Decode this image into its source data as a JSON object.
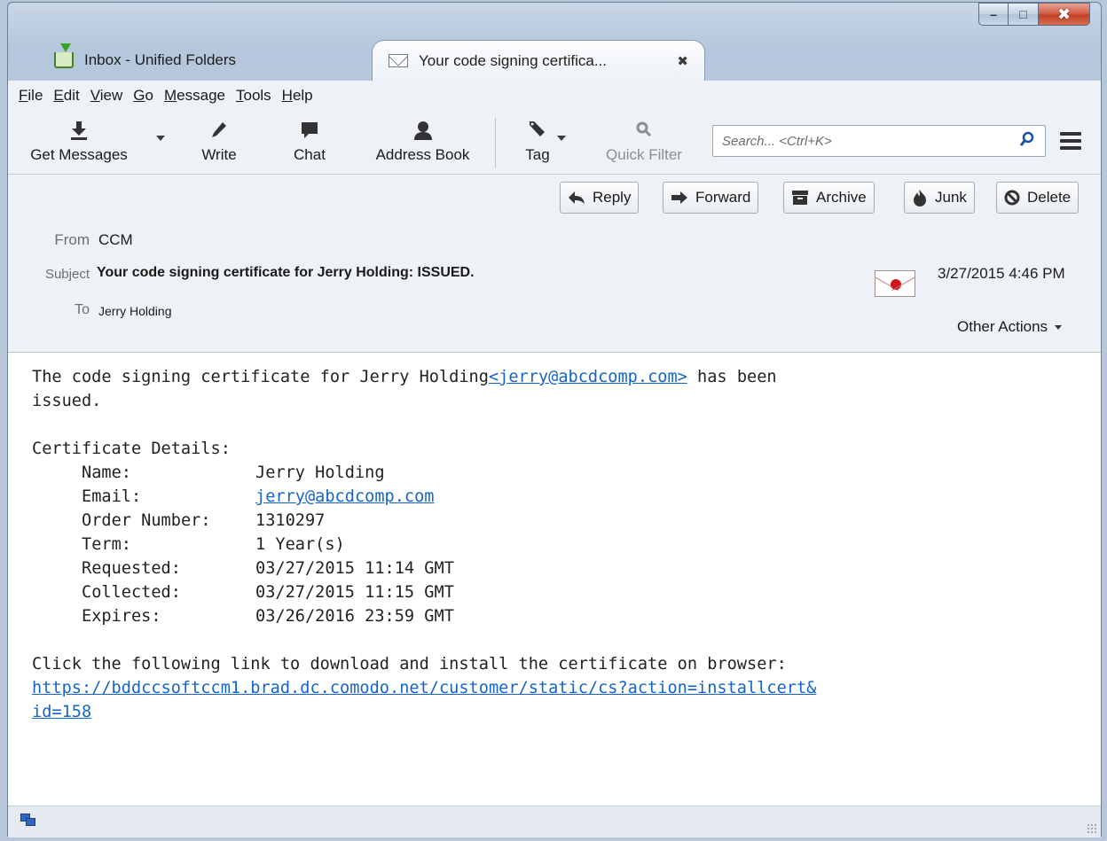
{
  "window": {
    "controls": {
      "minimize": "–",
      "maximize": "□",
      "close": "✖"
    }
  },
  "tabs": [
    {
      "title": "Inbox - Unified Folders",
      "icon": "inbox-download-icon",
      "active": false
    },
    {
      "title": "Your code signing certifica...",
      "icon": "envelope-icon",
      "active": true,
      "close": "✖"
    }
  ],
  "menubar": {
    "items": [
      {
        "key": "F",
        "rest": "ile"
      },
      {
        "key": "E",
        "rest": "dit"
      },
      {
        "key": "V",
        "rest": "iew"
      },
      {
        "key": "G",
        "rest": "o"
      },
      {
        "key": "M",
        "rest": "essage"
      },
      {
        "key": "T",
        "rest": "ools"
      },
      {
        "key": "H",
        "rest": "elp"
      }
    ]
  },
  "toolbar": {
    "get_messages": "Get Messages",
    "write": "Write",
    "chat": "Chat",
    "address_book": "Address Book",
    "tag": "Tag",
    "quick_filter": "Quick Filter",
    "search_placeholder": "Search... <Ctrl+K>"
  },
  "header_actions": {
    "reply": "Reply",
    "forward": "Forward",
    "archive": "Archive",
    "junk": "Junk",
    "delete": "Delete"
  },
  "message": {
    "from_label": "From",
    "from": "CCM",
    "subject_label": "Subject",
    "subject": "Your code signing certificate for Jerry Holding: ISSUED.",
    "to_label": "To",
    "to": "Jerry Holding",
    "date": "3/27/2015 4:46 PM",
    "other_actions": "Other Actions"
  },
  "body": {
    "intro_a": "The code signing certificate for Jerry Holding",
    "intro_link": "<jerry@abcdcomp.com>",
    "intro_b": " has been",
    "intro_c": "issued.",
    "details_heading": "Certificate Details:",
    "details": [
      {
        "key": "Name:",
        "value": "Jerry Holding",
        "link": false
      },
      {
        "key": "Email:",
        "value": "jerry@abcdcomp.com",
        "link": true
      },
      {
        "key": "Order Number:",
        "value": "1310297",
        "link": false
      },
      {
        "key": "Term:",
        "value": "1 Year(s)",
        "link": false
      },
      {
        "key": "Requested:",
        "value": "03/27/2015 11:14 GMT",
        "link": false
      },
      {
        "key": "Collected:",
        "value": "03/27/2015 11:15 GMT",
        "link": false
      },
      {
        "key": "Expires:",
        "value": "03/26/2016 23:59 GMT",
        "link": false
      }
    ],
    "install_text": "Click the following link to download and install the certificate on browser:",
    "install_link_line1": "https://bddccsoftccm1.brad.dc.comodo.net/customer/static/cs?action=installcert&",
    "install_link_line2": "id=158"
  }
}
